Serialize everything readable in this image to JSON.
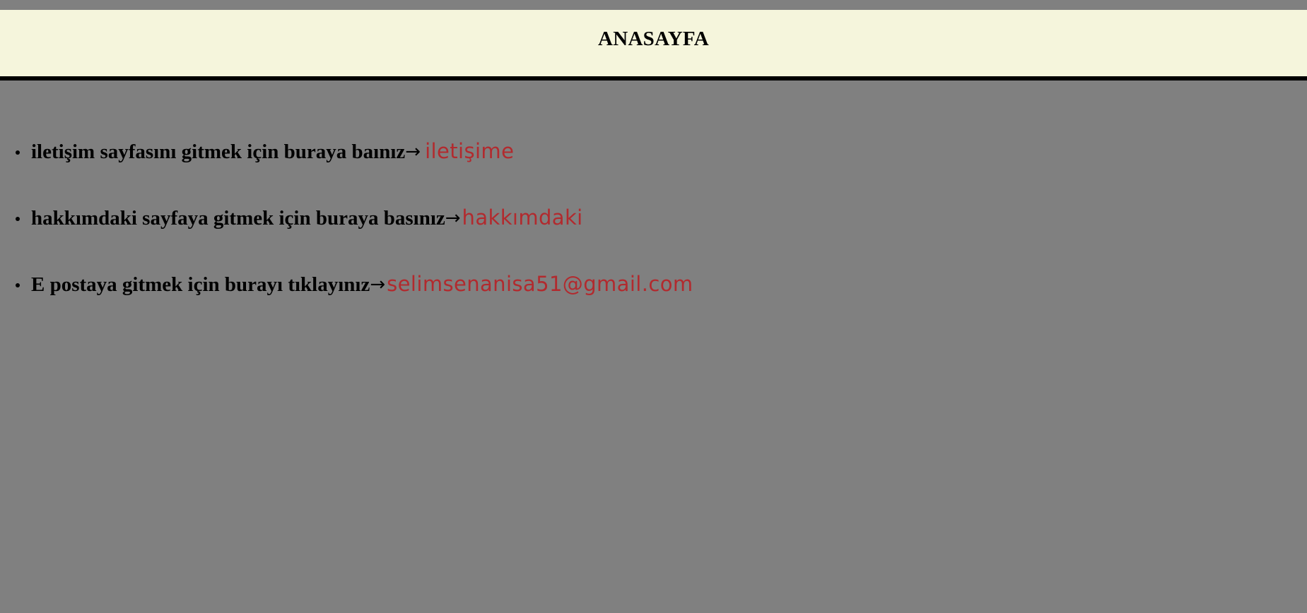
{
  "header": {
    "title": "ANASAYFA"
  },
  "nav": {
    "items": [
      {
        "lead": "iletişim sayfasını gitmek için buraya baınız",
        "arrow": "→",
        "link": "iletişime"
      },
      {
        "lead": "hakkımdaki sayfaya gitmek için buraya basınız",
        "arrow": "→",
        "link": "hakkımdaki"
      },
      {
        "lead": "E postaya gitmek için burayı tıklayınız",
        "arrow": "→",
        "link": "selimsenanisa51@gmail.com"
      }
    ]
  },
  "colors": {
    "page_background": "#808080",
    "header_background": "#f5f5dc",
    "header_border": "#000000",
    "link": "#b22a2e"
  }
}
